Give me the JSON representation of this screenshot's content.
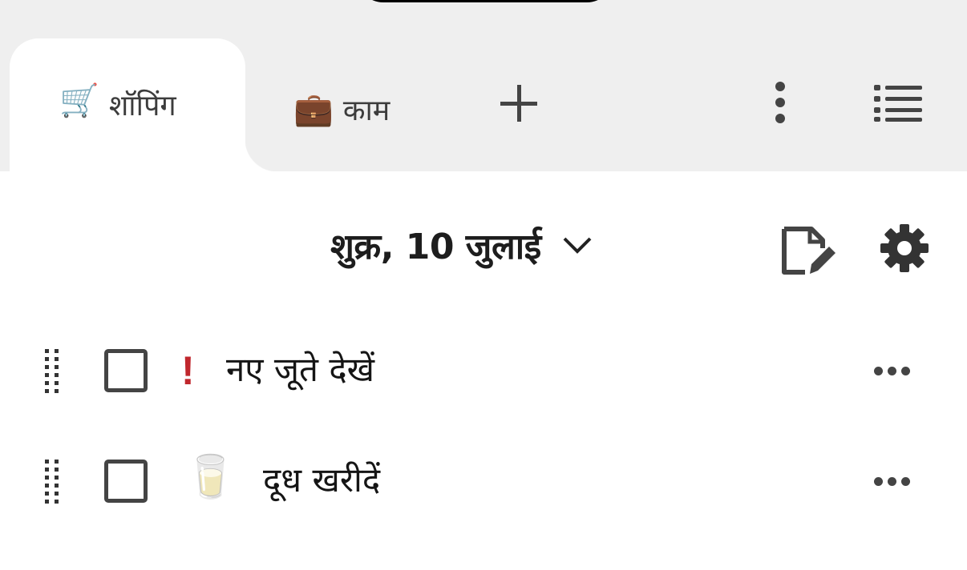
{
  "tabs": [
    {
      "icon": "🛒",
      "icon_name": "shopping-cart-icon",
      "label": "शॉपिंग",
      "active": true
    },
    {
      "icon": "💼",
      "icon_name": "briefcase-icon",
      "label": "काम",
      "active": false
    }
  ],
  "toolbar": {
    "add_tab_icon": "plus-icon",
    "menu_icon": "more-vertical-icon",
    "list_icon": "list-icon"
  },
  "header": {
    "date": "शुक्र, 10 जुलाई",
    "chevron_icon": "chevron-down-icon",
    "edit_icon": "edit-note-icon",
    "settings_icon": "gear-icon"
  },
  "items": [
    {
      "priority": "!",
      "emoji": "",
      "text": "नए जूते देखें",
      "checked": false
    },
    {
      "priority": "",
      "emoji": "🥛",
      "text": "दूध खरीदें",
      "checked": false
    }
  ],
  "colors": {
    "tabbar_bg": "#efefef",
    "priority": "#c0272d",
    "icon": "#444444"
  }
}
